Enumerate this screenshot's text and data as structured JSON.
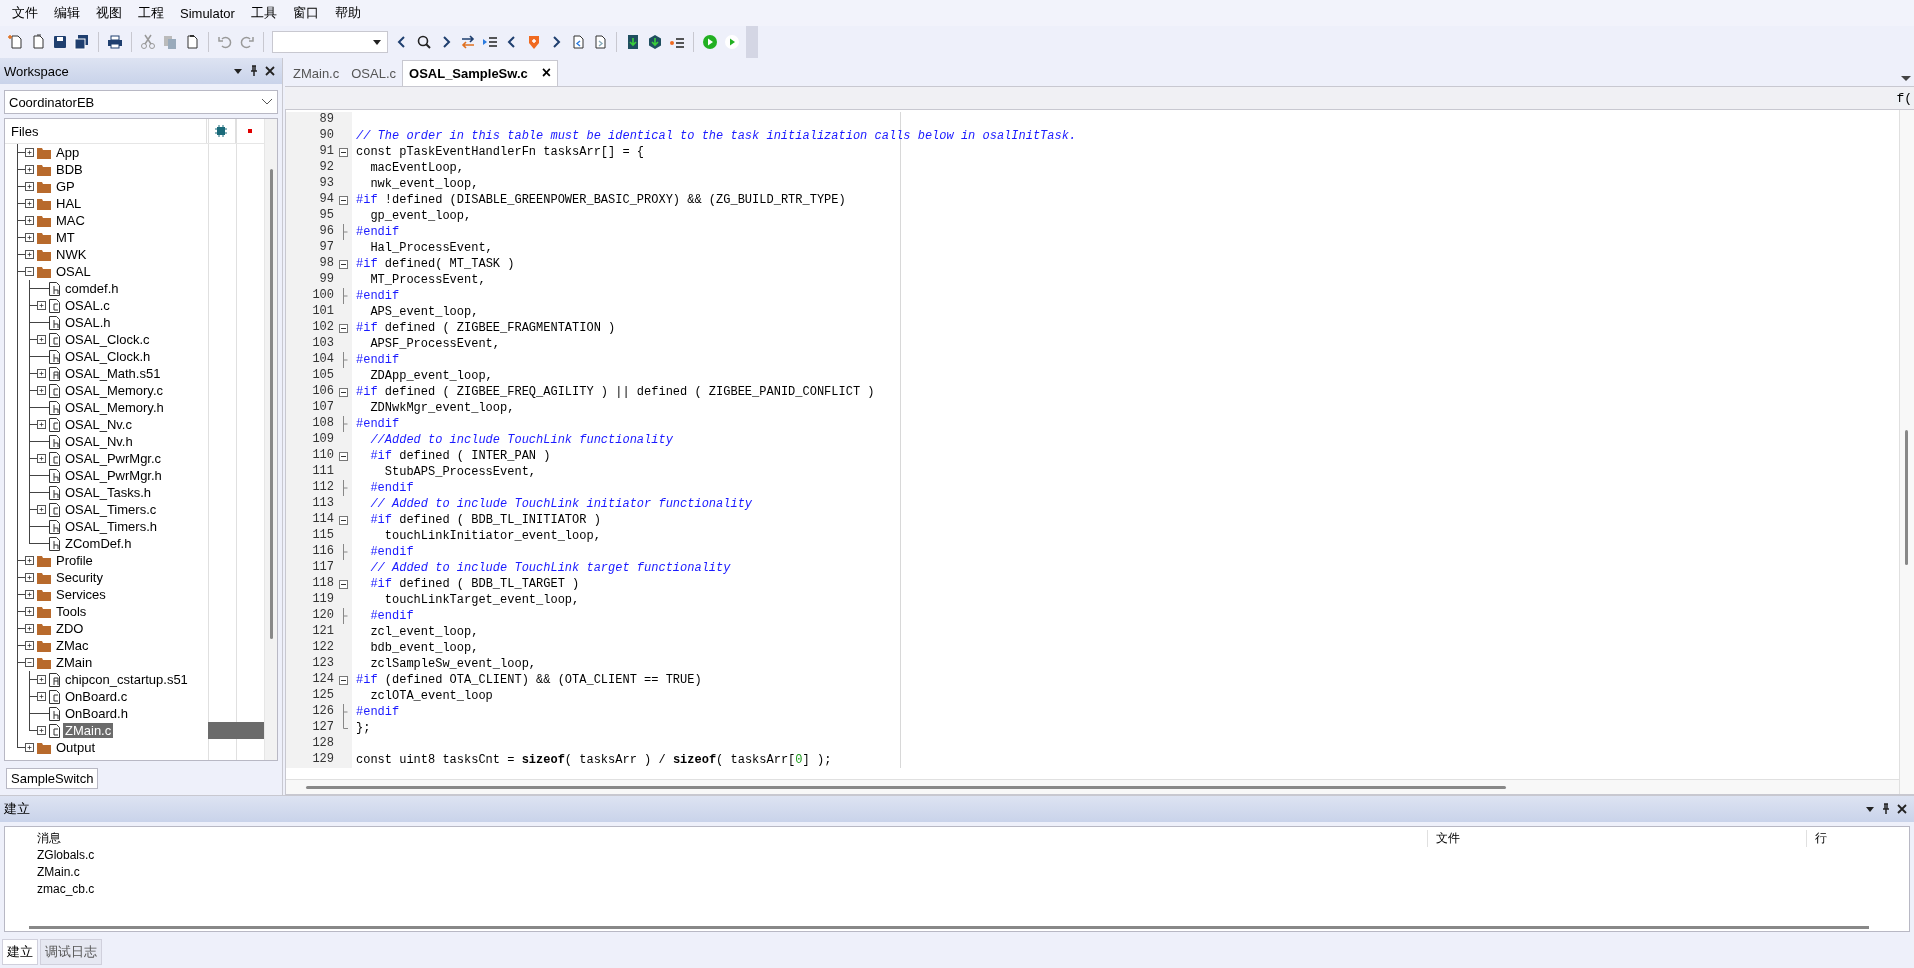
{
  "menu": [
    "文件",
    "编辑",
    "视图",
    "工程",
    "Simulator",
    "工具",
    "窗口",
    "帮助"
  ],
  "workspace": {
    "title": "Workspace",
    "configuration": "CoordinatorEB",
    "files_header": "Files",
    "tree": [
      {
        "label": "App",
        "kind": "folder",
        "expanded": false,
        "selected": false
      },
      {
        "label": "BDB",
        "kind": "folder",
        "expanded": false,
        "selected": false
      },
      {
        "label": "GP",
        "kind": "folder",
        "expanded": false,
        "selected": false
      },
      {
        "label": "HAL",
        "kind": "folder",
        "expanded": false,
        "selected": false
      },
      {
        "label": "MAC",
        "kind": "folder",
        "expanded": false,
        "selected": false
      },
      {
        "label": "MT",
        "kind": "folder",
        "expanded": false,
        "selected": false
      },
      {
        "label": "NWK",
        "kind": "folder",
        "expanded": false,
        "selected": false
      },
      {
        "label": "OSAL",
        "kind": "folder",
        "expanded": true,
        "selected": false,
        "children": [
          {
            "label": "comdef.h",
            "kind": "h",
            "selected": false
          },
          {
            "label": "OSAL.c",
            "kind": "c",
            "expanded": false,
            "selected": false
          },
          {
            "label": "OSAL.h",
            "kind": "h",
            "selected": false
          },
          {
            "label": "OSAL_Clock.c",
            "kind": "c",
            "expanded": false,
            "selected": false
          },
          {
            "label": "OSAL_Clock.h",
            "kind": "h",
            "selected": false
          },
          {
            "label": "OSAL_Math.s51",
            "kind": "asm",
            "expanded": false,
            "selected": false
          },
          {
            "label": "OSAL_Memory.c",
            "kind": "c",
            "expanded": false,
            "selected": false
          },
          {
            "label": "OSAL_Memory.h",
            "kind": "h",
            "selected": false
          },
          {
            "label": "OSAL_Nv.c",
            "kind": "c",
            "expanded": false,
            "selected": false
          },
          {
            "label": "OSAL_Nv.h",
            "kind": "h",
            "selected": false
          },
          {
            "label": "OSAL_PwrMgr.c",
            "kind": "c",
            "expanded": false,
            "selected": false
          },
          {
            "label": "OSAL_PwrMgr.h",
            "kind": "h",
            "selected": false
          },
          {
            "label": "OSAL_Tasks.h",
            "kind": "h",
            "selected": false
          },
          {
            "label": "OSAL_Timers.c",
            "kind": "c",
            "expanded": false,
            "selected": false
          },
          {
            "label": "OSAL_Timers.h",
            "kind": "h",
            "selected": false
          },
          {
            "label": "ZComDef.h",
            "kind": "h",
            "selected": false
          }
        ]
      },
      {
        "label": "Profile",
        "kind": "folder",
        "expanded": false,
        "selected": false
      },
      {
        "label": "Security",
        "kind": "folder",
        "expanded": false,
        "selected": false
      },
      {
        "label": "Services",
        "kind": "folder",
        "expanded": false,
        "selected": false
      },
      {
        "label": "Tools",
        "kind": "folder",
        "expanded": false,
        "selected": false
      },
      {
        "label": "ZDO",
        "kind": "folder",
        "expanded": false,
        "selected": false
      },
      {
        "label": "ZMac",
        "kind": "folder",
        "expanded": false,
        "selected": false
      },
      {
        "label": "ZMain",
        "kind": "folder",
        "expanded": true,
        "selected": false,
        "children": [
          {
            "label": "chipcon_cstartup.s51",
            "kind": "asm",
            "expanded": false,
            "selected": false
          },
          {
            "label": "OnBoard.c",
            "kind": "c",
            "expanded": false,
            "selected": false
          },
          {
            "label": "OnBoard.h",
            "kind": "h",
            "selected": false
          },
          {
            "label": "ZMain.c",
            "kind": "c",
            "expanded": false,
            "selected": true
          }
        ]
      },
      {
        "label": "Output",
        "kind": "folder",
        "expanded": false,
        "selected": false
      }
    ],
    "tabs": [
      {
        "label": "SampleSwitch",
        "selected": true
      }
    ]
  },
  "editor": {
    "tabs": [
      {
        "label": "ZMain.c",
        "selected": false
      },
      {
        "label": "OSAL.c",
        "selected": false
      },
      {
        "label": "OSAL_SampleSw.c",
        "selected": true,
        "close": "×"
      }
    ],
    "function_button": "f(",
    "lines": [
      {
        "n": "89",
        "kind": "plain"
      },
      {
        "n": "90",
        "kind": "plain",
        "code": [
          {
            "kind": "comment",
            "text": "// The order in this table must be identical to the task initialization calls below in osalInitTask."
          }
        ]
      },
      {
        "n": "91",
        "kind": "fold_start",
        "code": [
          {
            "kind": "text",
            "text": "const pTaskEventHandlerFn tasksArr[] = {"
          }
        ]
      },
      {
        "n": "92",
        "kind": "plain",
        "code": [
          {
            "kind": "text",
            "text": "  macEventLoop,"
          }
        ]
      },
      {
        "n": "93",
        "kind": "plain",
        "code": [
          {
            "kind": "text",
            "text": "  nwk_event_loop,"
          }
        ]
      },
      {
        "n": "94",
        "kind": "fold_start",
        "code": [
          {
            "kind": "preproc",
            "text": "#if"
          },
          {
            "kind": "text",
            "text": " !defined (DISABLE_GREENPOWER_BASIC_PROXY) && (ZG_BUILD_RTR_TYPE)"
          }
        ]
      },
      {
        "n": "95",
        "kind": "plain",
        "code": [
          {
            "kind": "text",
            "text": "  gp_event_loop,"
          }
        ]
      },
      {
        "n": "96",
        "kind": "fold_end",
        "code": [
          {
            "kind": "preproc",
            "text": "#endif"
          }
        ]
      },
      {
        "n": "97",
        "kind": "plain",
        "code": [
          {
            "kind": "text",
            "text": "  Hal_ProcessEvent,"
          }
        ]
      },
      {
        "n": "98",
        "kind": "fold_start",
        "code": [
          {
            "kind": "preproc",
            "text": "#if"
          },
          {
            "kind": "text",
            "text": " defined( MT_TASK )"
          }
        ]
      },
      {
        "n": "99",
        "kind": "plain",
        "code": [
          {
            "kind": "text",
            "text": "  MT_ProcessEvent,"
          }
        ]
      },
      {
        "n": "100",
        "kind": "fold_end",
        "code": [
          {
            "kind": "preproc",
            "text": "#endif"
          }
        ]
      },
      {
        "n": "101",
        "kind": "plain",
        "code": [
          {
            "kind": "text",
            "text": "  APS_event_loop,"
          }
        ]
      },
      {
        "n": "102",
        "kind": "fold_start",
        "code": [
          {
            "kind": "preproc",
            "text": "#if"
          },
          {
            "kind": "text",
            "text": " defined ( ZIGBEE_FRAGMENTATION )"
          }
        ]
      },
      {
        "n": "103",
        "kind": "plain",
        "code": [
          {
            "kind": "text",
            "text": "  APSF_ProcessEvent,"
          }
        ]
      },
      {
        "n": "104",
        "kind": "fold_end",
        "code": [
          {
            "kind": "preproc",
            "text": "#endif"
          }
        ]
      },
      {
        "n": "105",
        "kind": "plain",
        "code": [
          {
            "kind": "text",
            "text": "  ZDApp_event_loop,"
          }
        ]
      },
      {
        "n": "106",
        "kind": "fold_start",
        "code": [
          {
            "kind": "preproc",
            "text": "#if"
          },
          {
            "kind": "text",
            "text": " defined ( ZIGBEE_FREQ_AGILITY ) || defined ( ZIGBEE_PANID_CONFLICT )"
          }
        ]
      },
      {
        "n": "107",
        "kind": "plain",
        "code": [
          {
            "kind": "text",
            "text": "  ZDNwkMgr_event_loop,"
          }
        ]
      },
      {
        "n": "108",
        "kind": "fold_end",
        "code": [
          {
            "kind": "preproc",
            "text": "#endif"
          }
        ]
      },
      {
        "n": "109",
        "kind": "plain",
        "code": [
          {
            "kind": "comment",
            "text": "  //Added to include TouchLink functionality"
          }
        ]
      },
      {
        "n": "110",
        "kind": "fold_start",
        "code": [
          {
            "kind": "preproc",
            "text": "  #if"
          },
          {
            "kind": "text",
            "text": " defined ( INTER_PAN )"
          }
        ]
      },
      {
        "n": "111",
        "kind": "plain",
        "code": [
          {
            "kind": "text",
            "text": "    StubAPS_ProcessEvent,"
          }
        ]
      },
      {
        "n": "112",
        "kind": "fold_end",
        "code": [
          {
            "kind": "preproc",
            "text": "  #endif"
          }
        ]
      },
      {
        "n": "113",
        "kind": "plain",
        "code": [
          {
            "kind": "comment",
            "text": "  // Added to include TouchLink initiator functionality"
          }
        ]
      },
      {
        "n": "114",
        "kind": "fold_start",
        "code": [
          {
            "kind": "preproc",
            "text": "  #if"
          },
          {
            "kind": "text",
            "text": " defined ( BDB_TL_INITIATOR )"
          }
        ]
      },
      {
        "n": "115",
        "kind": "plain",
        "code": [
          {
            "kind": "text",
            "text": "    touchLinkInitiator_event_loop,"
          }
        ]
      },
      {
        "n": "116",
        "kind": "fold_end",
        "code": [
          {
            "kind": "preproc",
            "text": "  #endif"
          }
        ]
      },
      {
        "n": "117",
        "kind": "plain",
        "code": [
          {
            "kind": "comment",
            "text": "  // Added to include TouchLink target functionality"
          }
        ]
      },
      {
        "n": "118",
        "kind": "fold_start",
        "code": [
          {
            "kind": "preproc",
            "text": "  #if"
          },
          {
            "kind": "text",
            "text": " defined ( BDB_TL_TARGET )"
          }
        ]
      },
      {
        "n": "119",
        "kind": "plain",
        "code": [
          {
            "kind": "text",
            "text": "    touchLinkTarget_event_loop,"
          }
        ]
      },
      {
        "n": "120",
        "kind": "fold_end",
        "code": [
          {
            "kind": "preproc",
            "text": "  #endif"
          }
        ]
      },
      {
        "n": "121",
        "kind": "plain",
        "code": [
          {
            "kind": "text",
            "text": "  zcl_event_loop,"
          }
        ]
      },
      {
        "n": "122",
        "kind": "plain",
        "code": [
          {
            "kind": "text",
            "text": "  bdb_event_loop,"
          }
        ]
      },
      {
        "n": "123",
        "kind": "plain",
        "code": [
          {
            "kind": "text",
            "text": "  zclSampleSw_event_loop,"
          }
        ]
      },
      {
        "n": "124",
        "kind": "fold_start",
        "code": [
          {
            "kind": "preproc",
            "text": "#if"
          },
          {
            "kind": "text",
            "text": " (defined OTA_CLIENT) && (OTA_CLIENT == TRUE)"
          }
        ]
      },
      {
        "n": "125",
        "kind": "plain",
        "code": [
          {
            "kind": "text",
            "text": "  zclOTA_event_loop"
          }
        ]
      },
      {
        "n": "126",
        "kind": "fold_end",
        "code": [
          {
            "kind": "preproc",
            "text": "#endif"
          }
        ]
      },
      {
        "n": "127",
        "kind": "block_end",
        "code": [
          {
            "kind": "text",
            "text": "};"
          }
        ]
      },
      {
        "n": "128",
        "kind": "plain"
      },
      {
        "n": "129",
        "kind": "plain",
        "code": [
          {
            "kind": "text",
            "text": "const uint8 tasksCnt = "
          },
          {
            "kind": "keyword",
            "text": "sizeof"
          },
          {
            "kind": "text",
            "text": "( tasksArr ) / "
          },
          {
            "kind": "keyword",
            "text": "sizeof"
          },
          {
            "kind": "text",
            "text": "( tasksArr["
          },
          {
            "kind": "number",
            "text": "0"
          },
          {
            "kind": "text",
            "text": "] );"
          }
        ]
      }
    ]
  },
  "build": {
    "title": "建立",
    "columns": [
      "消息",
      "文件",
      "行"
    ],
    "rows": [
      {
        "message": "ZGlobals.c"
      },
      {
        "message": "ZMain.c"
      },
      {
        "message": "zmac_cb.c"
      }
    ]
  },
  "bottom_tabs": [
    {
      "label": "建立",
      "selected": true
    },
    {
      "label": "调试日志",
      "selected": false
    }
  ]
}
